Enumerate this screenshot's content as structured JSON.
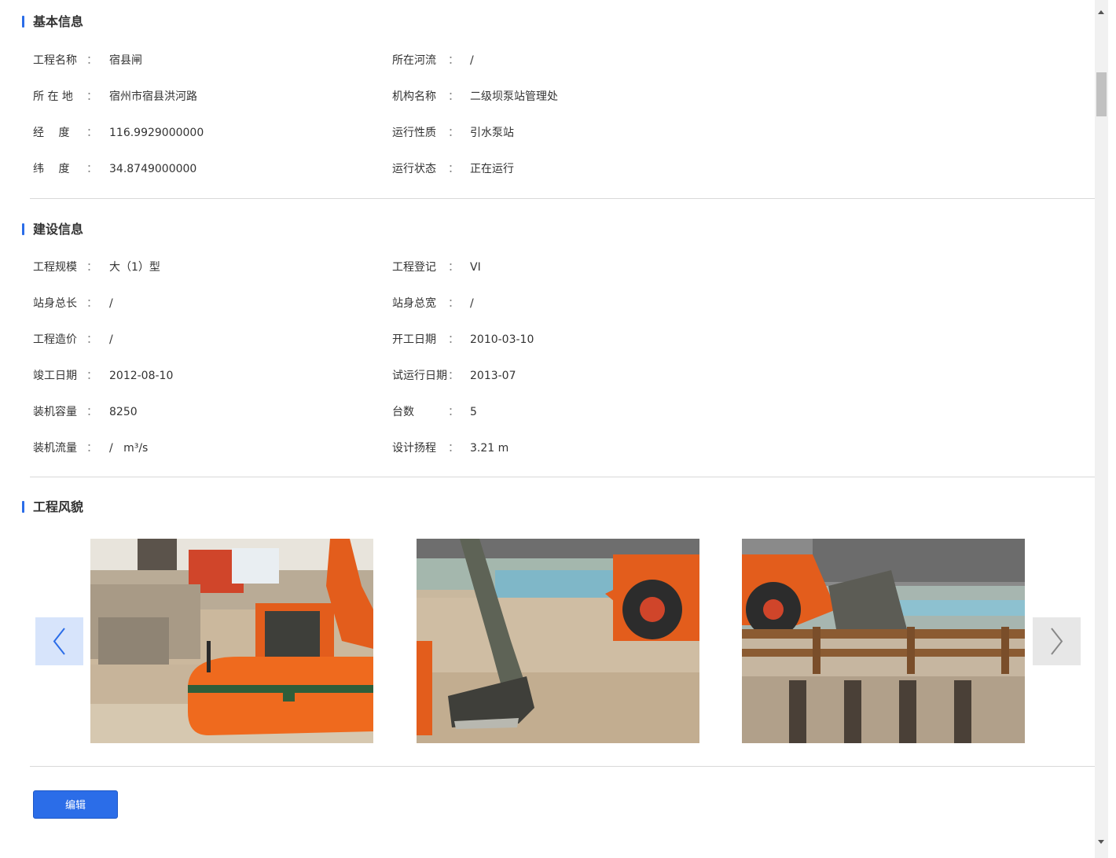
{
  "basic": {
    "title": "基本信息",
    "rows": [
      {
        "l1": "工程名称",
        "v1": "宿县闸",
        "l2": "所在河流",
        "v2": "/"
      },
      {
        "l1": "所 在 地",
        "v1": "宿州市宿县洪河路",
        "l2": "机构名称",
        "v2": "二级坝泵站管理处"
      },
      {
        "l1": "经　 度",
        "v1": "116.9929000000",
        "l2": "运行性质",
        "v2": "引水泵站"
      },
      {
        "l1": "纬　 度",
        "v1": "34.8749000000",
        "l2": "运行状态",
        "v2": "正在运行"
      }
    ]
  },
  "construction": {
    "title": "建设信息",
    "rows": [
      {
        "l1": "工程规模",
        "v1": "大（1）型",
        "l2": "工程登记",
        "v2": "VI"
      },
      {
        "l1": "站身总长",
        "v1": "/",
        "l2": "站身总宽",
        "v2": "/"
      },
      {
        "l1": "工程造价",
        "v1": "/",
        "l2": "开工日期",
        "v2": "2010-03-10"
      },
      {
        "l1": "竣工日期",
        "v1": "2012-08-10",
        "l2": "试运行日期",
        "v2": "2013-07"
      },
      {
        "l1": "装机容量",
        "v1": "8250",
        "l2": "台数",
        "v2": "5"
      },
      {
        "l1": "装机流量",
        "v1": "/   m³/s",
        "l2": "设计扬程",
        "v2": "3.21 m"
      }
    ]
  },
  "gallery": {
    "title": "工程风貌",
    "photos": [
      "excavator-photo",
      "excavator-bucket-photo",
      "wheel-loader-photo"
    ]
  },
  "colon": "：",
  "actions": {
    "edit_label": "编辑"
  },
  "colors": {
    "accent": "#2b6de8",
    "divider": "#d9d9d9",
    "prev_bg": "#d7e4fb",
    "next_bg": "#e7e7e7"
  }
}
